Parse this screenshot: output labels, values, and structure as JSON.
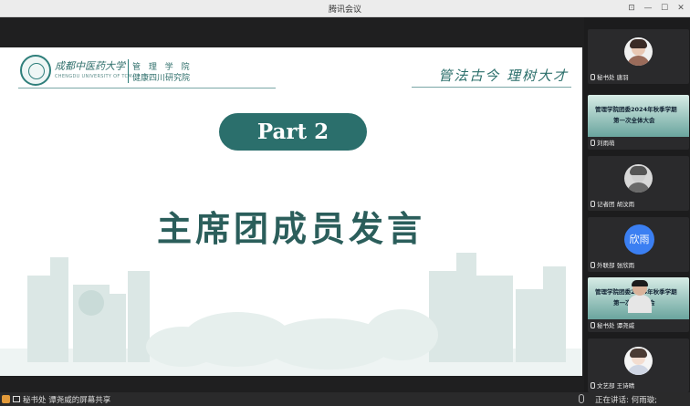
{
  "window": {
    "title": "腾讯会议",
    "buttons": {
      "pin": "⊡",
      "minimize": "—",
      "maximize": "☐",
      "close": "✕"
    }
  },
  "slide": {
    "logo_name": "成都中医药大学",
    "logo_en": "CHENGDU UNIVERSITY OF TCM",
    "logo_sub1": "管 理 学 院",
    "logo_sub2": "健康四川研究院",
    "motto": "管法古今  理树大才",
    "part_label": "Part 2",
    "title": "主席团成员发言"
  },
  "participants": [
    {
      "name": "秘书处 唐羽",
      "type": "avatar"
    },
    {
      "name": "刘雨萌",
      "type": "slide",
      "slide_line1": "管理学院团委2024年秋季学期",
      "slide_line2": "第一次全体大会"
    },
    {
      "name": "记者团 胡汶雨",
      "type": "avatar"
    },
    {
      "name": "外联部 张欣雨",
      "type": "text",
      "text_avatar": "欣雨"
    },
    {
      "name": "秘书处 谭尧威",
      "type": "camera",
      "slide_line1": "管理学院团委2024年秋季学期",
      "slide_line2": "第一次全体大会"
    },
    {
      "name": "文艺部 王诗晴",
      "type": "avatar"
    }
  ],
  "bottom": {
    "share_text": "秘书处 谭尧威的屏幕共享",
    "speaking_text": "正在讲话: 何雨璇;"
  },
  "colors": {
    "accent": "#2b6f6c",
    "text_avatar": "#3b7ff2"
  }
}
